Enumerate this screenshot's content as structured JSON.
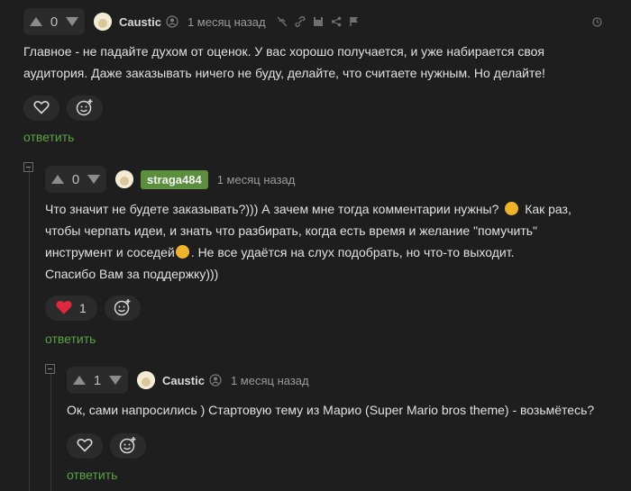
{
  "comments": [
    {
      "score": "0",
      "author": "Caustic",
      "time": "1 месяц назад",
      "text_lines": [
        "Главное - не падайте духом от оценок. У вас хорошо получается, и уже набирается своя",
        "аудитория. Даже заказывать ничего не буду, делайте, что считаете нужным. Но делайте!"
      ],
      "reply_label": "ответить"
    },
    {
      "score": "0",
      "author": "straga484",
      "time": "1 месяц назад",
      "text_lines": [
        "Что значит не будете заказывать?))) А зачем мне тогда комментарии нужны?",
        "Как раз,",
        "чтобы черпать идеи, и знать что разбирать, когда есть время и желание \"помучить\"",
        "инструмент и соседей",
        ". Не все удаётся на слух подобрать, но что-то выходит.",
        "Спасибо Вам за поддержку)))"
      ],
      "like_count": "1",
      "reply_label": "ответить"
    },
    {
      "score": "1",
      "author": "Caustic",
      "time": "1 месяц назад",
      "text_lines": [
        "Ок, сами напросились ) Стартовую тему из Марио (Super Mario bros theme) - возьмётесь?"
      ],
      "reply_label": "ответить"
    }
  ],
  "colors": {
    "background": "#1e1e1e",
    "reply_link": "#5aa243",
    "author_badge": "#5b8f3e",
    "heart_active": "#e0283c"
  },
  "icons": [
    "arrow-up-icon",
    "arrow-down-icon",
    "person-icon",
    "hide-icon",
    "link-icon",
    "save-icon",
    "share-icon",
    "flag-icon",
    "clock-icon",
    "heart-icon",
    "emoji-add-icon",
    "collapse-icon"
  ]
}
